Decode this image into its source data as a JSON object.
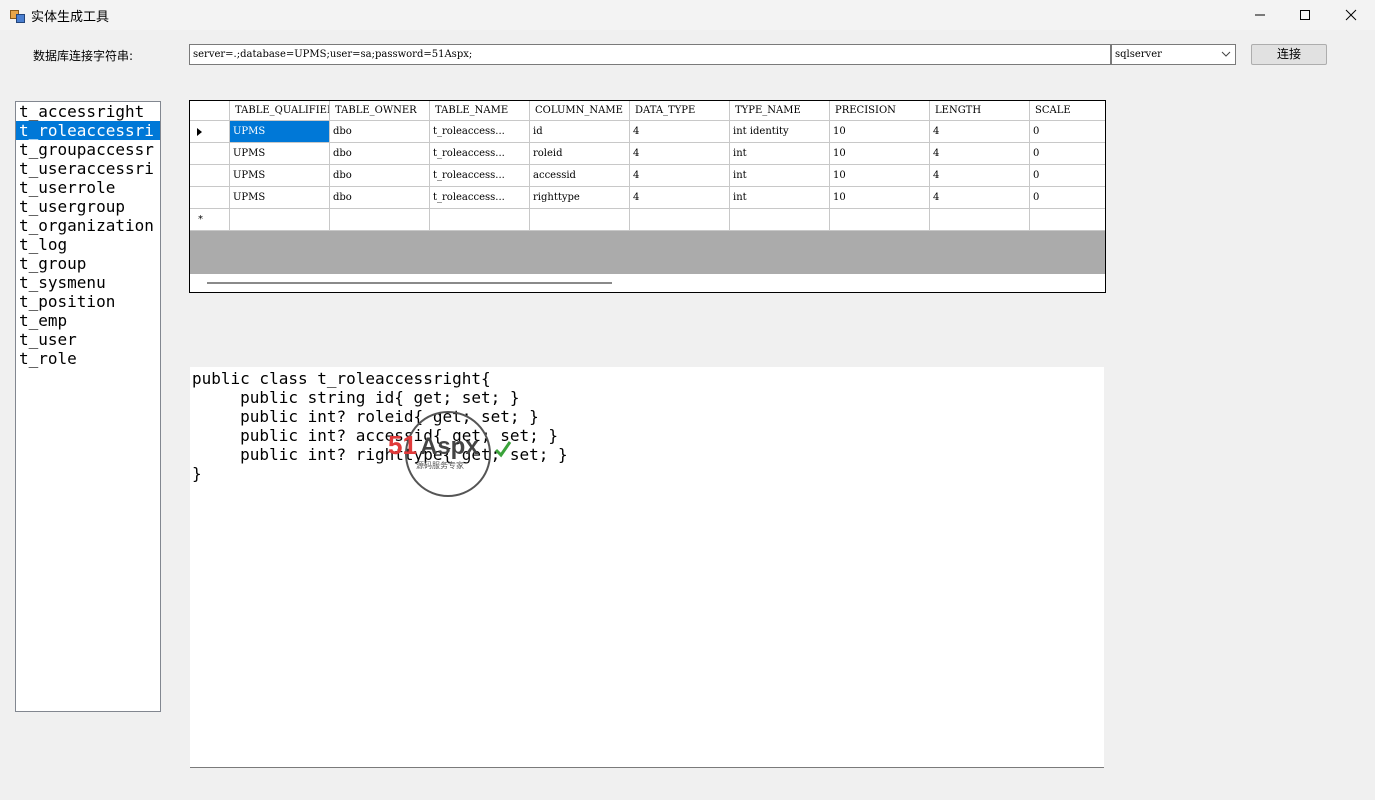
{
  "window": {
    "title": "实体生成工具"
  },
  "connection": {
    "label": "数据库连接字符串:",
    "value": "server=.;database=UPMS;user=sa;password=51Aspx;",
    "db_type": "sqlserver",
    "connect_label": "连接"
  },
  "tables": [
    "t_accessright",
    "t_roleaccessri",
    "t_groupaccessr",
    "t_useraccessri",
    "t_userrole",
    "t_usergroup",
    "t_organization",
    "t_log",
    "t_group",
    "t_sysmenu",
    "t_position",
    "t_emp",
    "t_user",
    "t_role"
  ],
  "selected_table_index": 1,
  "grid": {
    "columns": [
      "TABLE_QUALIFIER",
      "TABLE_OWNER",
      "TABLE_NAME",
      "COLUMN_NAME",
      "DATA_TYPE",
      "TYPE_NAME",
      "PRECISION",
      "LENGTH",
      "SCALE"
    ],
    "rows": [
      [
        "UPMS",
        "dbo",
        "t_roleaccess...",
        "id",
        "4",
        "int identity",
        "10",
        "4",
        "0"
      ],
      [
        "UPMS",
        "dbo",
        "t_roleaccess...",
        "roleid",
        "4",
        "int",
        "10",
        "4",
        "0"
      ],
      [
        "UPMS",
        "dbo",
        "t_roleaccess...",
        "accessid",
        "4",
        "int",
        "10",
        "4",
        "0"
      ],
      [
        "UPMS",
        "dbo",
        "t_roleaccess...",
        "righttype",
        "4",
        "int",
        "10",
        "4",
        "0"
      ]
    ],
    "new_row_marker": "*"
  },
  "code": {
    "lines": [
      "public class t_roleaccessright{",
      "     public string id{ get; set; }",
      "     public int? roleid{ get; set; }",
      "     public int? accessid{ get; set; }",
      "     public int? righttype{ get; set; }",
      "}"
    ]
  },
  "watermark": {
    "brand_a": "51",
    "brand_b": "Aspx",
    "tagline": "源码服务专家"
  },
  "colors": {
    "selection": "#0078d7",
    "watermark_red": "#e03a3a",
    "watermark_green": "#3aa33a"
  }
}
